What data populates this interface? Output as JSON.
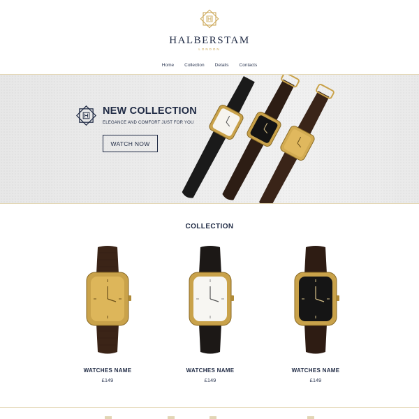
{
  "brand": {
    "name": "HALBERSTAM",
    "subtitle": "LONDON",
    "accent_color": "#c8a24c",
    "navy_color": "#1f2a44",
    "logo_icon": "geometric-star-logo"
  },
  "nav": {
    "items": [
      {
        "label": "Home"
      },
      {
        "label": "Collection"
      },
      {
        "label": "Details"
      },
      {
        "label": "Contacts"
      }
    ]
  },
  "hero": {
    "title": "NEW COLLECTION",
    "subtitle": "ELEGANCE AND COMFORT JUST FOR YOU",
    "cta_label": "WATCH NOW",
    "icon": "geometric-star-icon"
  },
  "collection": {
    "title": "COLLECTION",
    "products": [
      {
        "name": "WATCHES NAME",
        "price": "£149",
        "dial": "gold",
        "strap": "brown"
      },
      {
        "name": "WATCHES NAME",
        "price": "£149",
        "dial": "white",
        "strap": "black"
      },
      {
        "name": "WATCHES NAME",
        "price": "£149",
        "dial": "black",
        "strap": "brown"
      }
    ]
  }
}
